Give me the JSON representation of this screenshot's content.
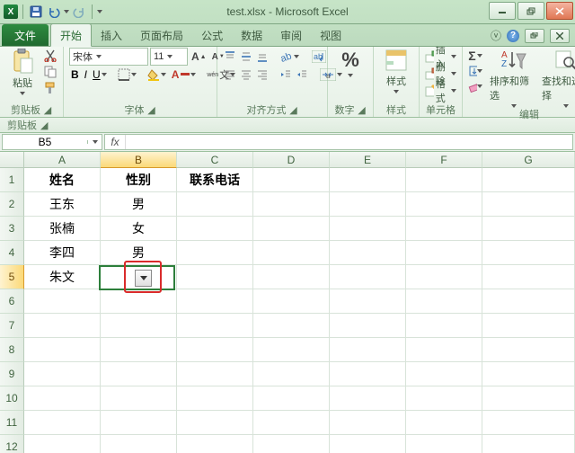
{
  "title": "test.xlsx - Microsoft Excel",
  "tabs": {
    "file": "文件",
    "items": [
      "开始",
      "插入",
      "页面布局",
      "公式",
      "数据",
      "审阅",
      "视图"
    ],
    "active": 0
  },
  "ribbon": {
    "clipboard": {
      "paste": "粘贴",
      "label": "剪贴板"
    },
    "font": {
      "name": "宋体",
      "size": "11",
      "label": "字体"
    },
    "align": {
      "label": "对齐方式"
    },
    "number": {
      "fmt": "%",
      "label": "数字"
    },
    "styles": {
      "styles": "样式",
      "label": "样式"
    },
    "cells": {
      "insert": "插入",
      "delete": "删除",
      "format": "格式",
      "label": "单元格"
    },
    "editing": {
      "sort": "排序和筛选",
      "find": "查找和选择",
      "label": "编辑"
    },
    "clipstrip": "剪贴板"
  },
  "formula_bar": {
    "name": "B5",
    "fx": "fx"
  },
  "sheet": {
    "cols": [
      "A",
      "B",
      "C",
      "D",
      "E",
      "F",
      "G"
    ],
    "rows": [
      "1",
      "2",
      "3",
      "4",
      "5",
      "6",
      "7",
      "8",
      "9",
      "10",
      "11",
      "12"
    ],
    "active": {
      "row": 5,
      "col": 2
    },
    "data": {
      "1": {
        "A": "姓名",
        "B": "性别",
        "C": "联系电话"
      },
      "2": {
        "A": "王东",
        "B": "男"
      },
      "3": {
        "A": "张楠",
        "B": "女"
      },
      "4": {
        "A": "李四",
        "B": "男"
      },
      "5": {
        "A": "朱文"
      }
    }
  }
}
